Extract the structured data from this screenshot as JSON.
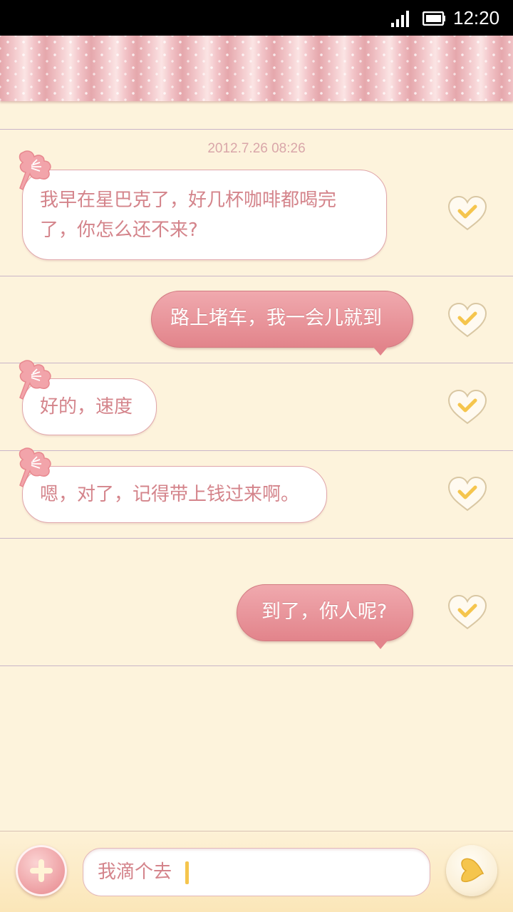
{
  "status_bar": {
    "time": "12:20"
  },
  "conversation": {
    "timestamp": "2012.7.26  08:26",
    "messages": [
      {
        "direction": "incoming",
        "lines": [
          "我早在星巴克了，好几杯咖啡都喝完",
          "了，你怎么还不来?"
        ]
      },
      {
        "direction": "outgoing",
        "text": "路上堵车，我一会儿就到"
      },
      {
        "direction": "incoming",
        "text": "好的，速度"
      },
      {
        "direction": "incoming",
        "text": "嗯，对了，记得带上钱过来啊。"
      },
      {
        "direction": "outgoing",
        "text": "到了，你人呢?"
      }
    ]
  },
  "composer": {
    "input_value": "我滴个去"
  },
  "colors": {
    "background": "#fdf3dc",
    "bubble_outgoing": "#e2848b",
    "text_incoming": "#d4848b",
    "accent_yellow": "#f5c54d"
  }
}
